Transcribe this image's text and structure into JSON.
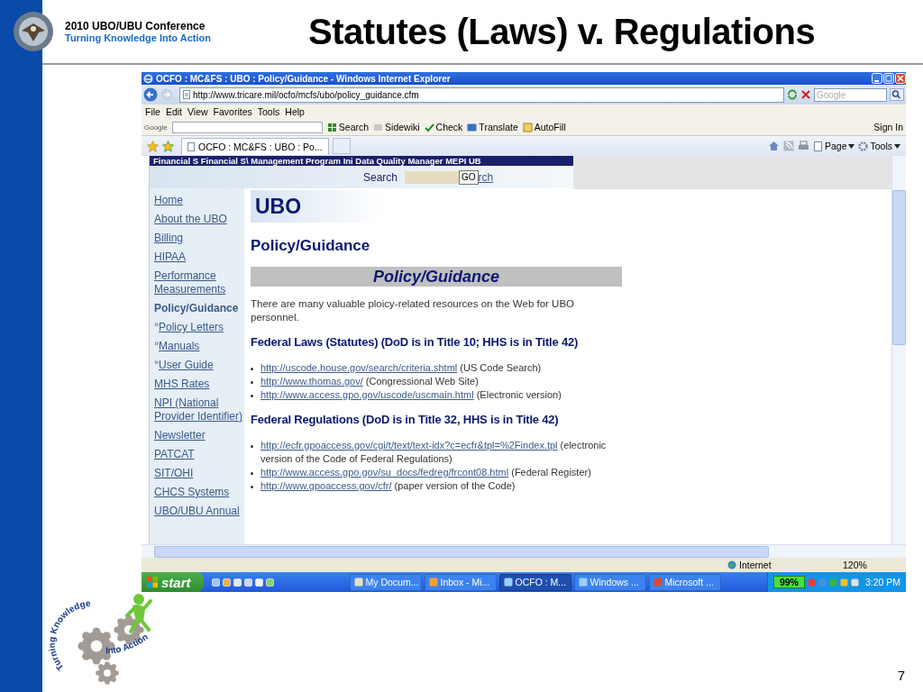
{
  "slide": {
    "conference": "2010 UBO/UBU Conference",
    "tagline": "Turning Knowledge Into Action",
    "title": "Statutes (Laws) v. Regulations",
    "logo_text": [
      "Turning Knowledge",
      "Into Action"
    ],
    "page_number": "7"
  },
  "browser": {
    "title": "OCFO : MC&FS : UBO : Policy/Guidance - Windows Internet Explorer",
    "address": "http://www.tricare.mil/ocfo/mcfs/ubo/policy_guidance.cfm",
    "search_placeholder": "Google",
    "menu": [
      "File",
      "Edit",
      "View",
      "Favorites",
      "Tools",
      "Help"
    ],
    "google_toolbar": {
      "logo": "Google",
      "items": [
        "Search",
        "Sidewiki",
        "Check",
        "Translate",
        "AutoFill"
      ],
      "sign_in": "Sign In"
    },
    "tab": "OCFO : MC&FS : UBO : Po...",
    "commands": [
      "Page",
      "Tools"
    ]
  },
  "page": {
    "banner": "Financial S Financial S\\ Management  Program Ini Data Quality Manager MEPI UB",
    "search_label": "Search",
    "go": "GO",
    "search_link": "rch",
    "nav": [
      {
        "kind": "link",
        "label": "Home"
      },
      {
        "kind": "link",
        "label": "About the UBO"
      },
      {
        "kind": "link",
        "label": "Billing"
      },
      {
        "kind": "link",
        "label": "HIPAA"
      },
      {
        "kind": "link",
        "label": "Performance Measurements"
      },
      {
        "kind": "current",
        "label": "Policy/Guidance"
      },
      {
        "kind": "sub",
        "marker": "»",
        "label": "Policy Letters"
      },
      {
        "kind": "sub",
        "marker": "»",
        "label": "Manuals"
      },
      {
        "kind": "sub",
        "marker": "»",
        "label": "User Guide"
      },
      {
        "kind": "link",
        "label": "MHS Rates"
      },
      {
        "kind": "link",
        "label": "NPI (National Provider Identifier)"
      },
      {
        "kind": "link",
        "label": "Newsletter"
      },
      {
        "kind": "link",
        "label": "PATCAT"
      },
      {
        "kind": "link",
        "label": "SIT/OHI"
      },
      {
        "kind": "link",
        "label": "CHCS Systems"
      },
      {
        "kind": "link",
        "label": "UBO/UBU Annual"
      }
    ],
    "heading": "UBO",
    "subheading": "Policy/Guidance",
    "band": "Policy/Guidance",
    "intro": "There are many valuable ploicy-related resources on the Web for UBO personnel.",
    "sections": [
      {
        "heading": "Federal Laws (Statutes) (DoD is in Title 10; HHS is in Title 42)",
        "links": [
          {
            "url": "http://uscode.house.gov/search/criteria.shtml",
            "note": "(US Code Search)"
          },
          {
            "url": "http://www.thomas.gov/",
            "note": "(Congressional Web Site)"
          },
          {
            "url": "http://www.access.gpo.gov/uscode/uscmain.html",
            "note": "(Electronic version)"
          }
        ]
      },
      {
        "heading": "Federal Regulations (DoD is in Title 32, HHS is in Title 42)",
        "links": [
          {
            "url": "http://ecfr.gpoaccess.gov/cgi/t/text/text-idx?c=ecfr&tpl=%2Findex.tpl",
            "note": "(electronic version of the Code of Federal Regulations)"
          },
          {
            "url": "http://www.access.gpo.gov/su_docs/fedreg/frcont08.html",
            "note": "(Federal Register)"
          },
          {
            "url": "http://www.gpoaccess.gov/cfr/",
            "note": "(paper version of the Code)"
          }
        ]
      }
    ]
  },
  "status_bar": {
    "zone": "Internet",
    "zoom": "120%"
  },
  "taskbar": {
    "start": "start",
    "tasks": [
      {
        "label": "My Docum...",
        "selected": false
      },
      {
        "label": "Inbox - Mi...",
        "selected": false
      },
      {
        "label": "OCFO : M...",
        "selected": true
      },
      {
        "label": "Windows ...",
        "selected": false
      },
      {
        "label": "Microsoft ...",
        "selected": false
      }
    ],
    "battery": "99%",
    "clock": "3:20 PM"
  }
}
